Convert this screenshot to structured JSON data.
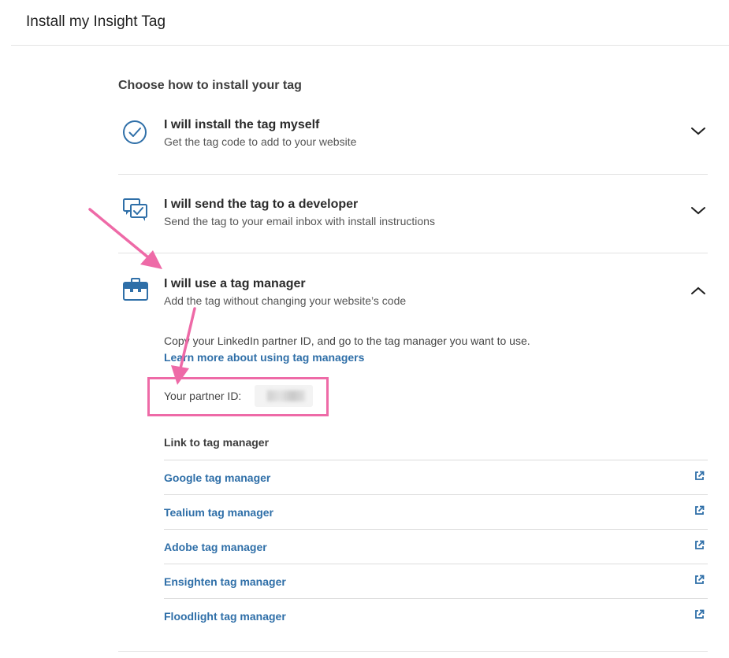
{
  "header": {
    "title": "Install my Insight Tag"
  },
  "section_heading": "Choose how to install your tag",
  "options": [
    {
      "title": "I will install the tag myself",
      "description": "Get the tag code to add to your website",
      "icon": "check-circle-icon",
      "expanded": false
    },
    {
      "title": "I will send the tag to a developer",
      "description": "Send the tag to your email inbox with install instructions",
      "icon": "chat-check-icon",
      "expanded": false
    },
    {
      "title": "I will use a tag manager",
      "description": "Add the tag without changing your website’s code",
      "icon": "briefcase-icon",
      "expanded": true
    }
  ],
  "tag_manager": {
    "instructions": "Copy your LinkedIn partner ID, and go to the tag manager you want to use.",
    "learn_more": "Learn more about using tag managers",
    "partner_label": "Your partner ID:",
    "link_heading": "Link to tag manager",
    "links": [
      "Google tag manager",
      "Tealium tag manager",
      "Adobe tag manager",
      "Ensighten tag manager",
      "Floodlight tag manager"
    ]
  },
  "colors": {
    "link": "#2f6fa8",
    "icon": "#2f6fa8",
    "annotation": "#ee6aa7"
  }
}
